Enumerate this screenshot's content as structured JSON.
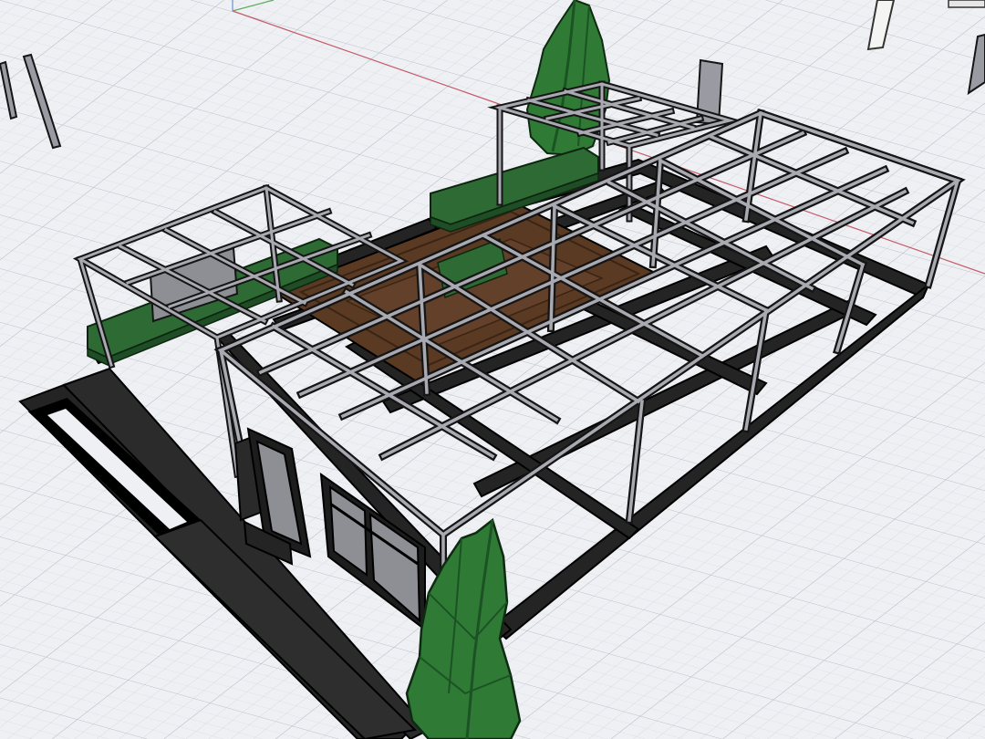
{
  "viewport": {
    "background": "#eef0f3",
    "grid_color": "#c9ced6",
    "grid_major_color": "#b7bdc7",
    "axis_x_color": "#c65a6a",
    "axis_y_color": "#5fae5f"
  },
  "scene": {
    "foundation_color": "#242424",
    "frame_fill": "#a9a9b1",
    "frame_stroke": "#151515",
    "floor_color": "#5a3a23",
    "hedge_color": "#2e6b34",
    "hedge_dark": "#1f4d25",
    "tree_color": "#2f7a35",
    "tree_dark": "#1c5324",
    "glass_color": "#8e8e95",
    "post_color": "#9a9aa2",
    "objects": [
      {
        "name": "slab-foundation",
        "kind": "foundation"
      },
      {
        "name": "entrance-walkway",
        "kind": "walkway"
      },
      {
        "name": "wooden-floor-deck",
        "kind": "floor"
      },
      {
        "name": "steel-frame-left-wing",
        "kind": "frame"
      },
      {
        "name": "steel-frame-main-hall",
        "kind": "frame"
      },
      {
        "name": "steel-frame-rear-wing",
        "kind": "frame"
      },
      {
        "name": "hedge-planter",
        "kind": "hedge"
      },
      {
        "name": "cypress-tree-back",
        "kind": "tree"
      },
      {
        "name": "cypress-tree-front",
        "kind": "tree"
      },
      {
        "name": "glass-door",
        "kind": "door"
      },
      {
        "name": "glass-window-panel",
        "kind": "window"
      }
    ]
  }
}
